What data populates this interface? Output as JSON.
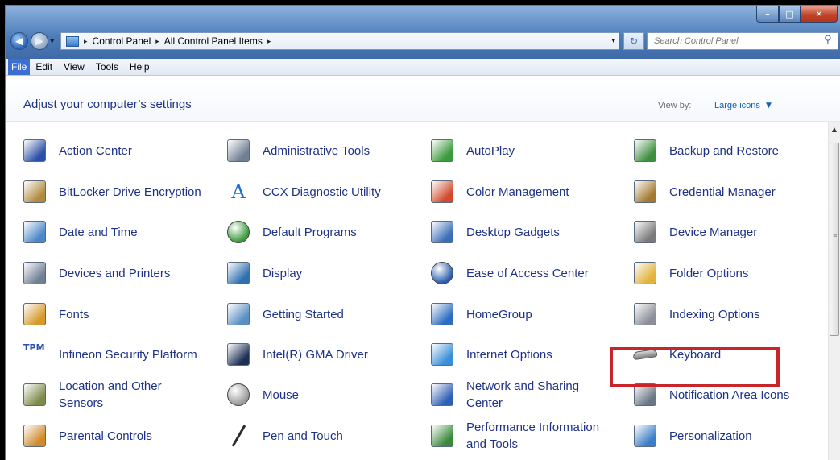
{
  "window": {
    "controls": {
      "minimize": "–",
      "maximize": "□",
      "close": "✕"
    }
  },
  "address": {
    "crumbs": [
      "Control Panel",
      "All Control Panel Items"
    ],
    "separator": "▸",
    "dropdown_glyph": "▾",
    "refresh_glyph": "↻",
    "search_placeholder": "Search Control Panel"
  },
  "menu": {
    "items": [
      "File",
      "Edit",
      "View",
      "Tools",
      "Help"
    ]
  },
  "header": {
    "title": "Adjust your computer’s settings",
    "view_by_label": "View by:",
    "view_by_value": "Large icons",
    "view_by_arrow": "▼"
  },
  "items": [
    {
      "label": "Action Center",
      "icon": "flag-icon",
      "color": "#2a4fa8"
    },
    {
      "label": "Administrative Tools",
      "icon": "admin-tools-icon",
      "color": "#6f7f94"
    },
    {
      "label": "AutoPlay",
      "icon": "autoplay-icon",
      "color": "#3b9a3b"
    },
    {
      "label": "Backup and Restore",
      "icon": "backup-icon",
      "color": "#3e8f3e"
    },
    {
      "label": "BitLocker Drive Encryption",
      "icon": "key-icon",
      "color": "#b08a3e"
    },
    {
      "label": "CCX Diagnostic Utility",
      "icon": "ccx-icon",
      "color": "#1a6fd0"
    },
    {
      "label": "Color Management",
      "icon": "color-management-icon",
      "color": "#d24a2b"
    },
    {
      "label": "Credential Manager",
      "icon": "vault-icon",
      "color": "#a37a2e"
    },
    {
      "label": "Date and Time",
      "icon": "calendar-clock-icon",
      "color": "#4a86c8"
    },
    {
      "label": "Default Programs",
      "icon": "default-programs-icon",
      "color": "#3b9a3b"
    },
    {
      "label": "Desktop Gadgets",
      "icon": "gadgets-icon",
      "color": "#3a6fb8"
    },
    {
      "label": "Device Manager",
      "icon": "device-manager-icon",
      "color": "#7a7a7a"
    },
    {
      "label": "Devices and Printers",
      "icon": "printer-icon",
      "color": "#6f7f94"
    },
    {
      "label": "Display",
      "icon": "display-icon",
      "color": "#2f6fb0"
    },
    {
      "label": "Ease of Access Center",
      "icon": "ease-of-access-icon",
      "color": "#2b5cae"
    },
    {
      "label": "Folder Options",
      "icon": "folder-icon",
      "color": "#e2b33c"
    },
    {
      "label": "Fonts",
      "icon": "fonts-icon",
      "color": "#d79a2a"
    },
    {
      "label": "Getting Started",
      "icon": "getting-started-icon",
      "color": "#5b8fc4"
    },
    {
      "label": "HomeGroup",
      "icon": "homegroup-icon",
      "color": "#2c6dc2"
    },
    {
      "label": "Indexing Options",
      "icon": "indexing-icon",
      "color": "#8a8f98"
    },
    {
      "label": "Infineon Security Platform",
      "icon": "tpm-icon",
      "color": "#2a4fa8",
      "glyph": "TPM"
    },
    {
      "label": "Intel(R) GMA Driver",
      "icon": "intel-gma-icon",
      "color": "#1c2f55"
    },
    {
      "label": "Internet Options",
      "icon": "internet-options-icon",
      "color": "#3a8fd8"
    },
    {
      "label": "Keyboard",
      "icon": "keyboard-icon",
      "color": "#7d7d7d"
    },
    {
      "label": "Location and Other Sensors",
      "icon": "sensors-icon",
      "color": "#7c8c4a"
    },
    {
      "label": "Mouse",
      "icon": "mouse-icon",
      "color": "#9a9a9a"
    },
    {
      "label": "Network and Sharing Center",
      "icon": "network-icon",
      "color": "#2f5fb5"
    },
    {
      "label": "Notification Area Icons",
      "icon": "notification-icon",
      "color": "#6b7785"
    },
    {
      "label": "Parental Controls",
      "icon": "parental-controls-icon",
      "color": "#d08a2a"
    },
    {
      "label": "Pen and Touch",
      "icon": "pen-icon",
      "color": "#2a2a2a"
    },
    {
      "label": "Performance Information and Tools",
      "icon": "performance-icon",
      "color": "#3b8a3b"
    },
    {
      "label": "Personalization",
      "icon": "personalization-icon",
      "color": "#3a7dc8"
    }
  ]
}
